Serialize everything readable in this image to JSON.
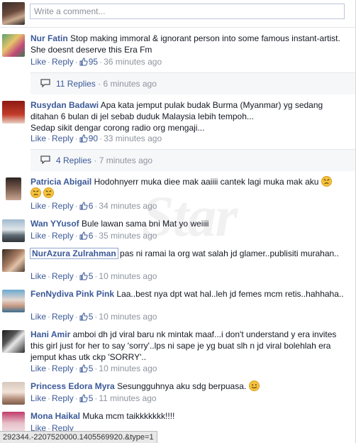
{
  "composer": {
    "placeholder": "Write a comment..."
  },
  "watermark": "Star",
  "action_labels": {
    "like": "Like",
    "reply": "Reply"
  },
  "comments": [
    {
      "author": "Nur Fatin",
      "text": "Stop making immoral & ignorant person into some famous instant-artist. She doesnt deserve this Era Fm",
      "likes": "95",
      "time": "36 minutes ago",
      "replies": {
        "count": "11 Replies",
        "time": "6 minutes ago"
      }
    },
    {
      "author": "Rusydan Badawi",
      "text": "Apa kata jemput pulak budak Burma (Myanmar) yg sedang ditahan 6 bulan di jel sebab duduk Malaysia lebih tempoh...",
      "text2": "Sedap sikit dengar corong radio org mengaji...",
      "likes": "90",
      "time": "33 minutes ago",
      "replies": {
        "count": "4 Replies",
        "time": "7 minutes ago"
      }
    },
    {
      "author": "Patricia Abigail",
      "text": "Hodohnyerr muka diee mak aaiiii cantek lagi muka mak aku",
      "likes": "6",
      "time": "34 minutes ago"
    },
    {
      "author": "Wan YYusof",
      "text": "Bule lawan sama bni Mat yo weiiii",
      "likes": "6",
      "time": "35 minutes ago"
    },
    {
      "author": "NurAzura Zulrahman",
      "text": "pas ni ramai la org wat salah jd glamer..publisiti murahan..",
      "likes": "5",
      "time": "10 minutes ago"
    },
    {
      "author": "FenNydiva Pink Pink",
      "text": "Laa..best nya dpt wat hal..leh jd femes mcm retis..hahhaha..",
      "likes": "5",
      "time": "10 minutes ago"
    },
    {
      "author": "Hani Amir",
      "text": "amboi dh jd viral baru nk mintak maaf...i don't understand y era invites this girl just for her to say 'sorry'..lps ni sape je yg buat slh n jd viral bolehlah era jemput khas utk ckp 'SORRY'..",
      "likes": "5",
      "time": "10 minutes ago"
    },
    {
      "author": "Princess Edora Myra",
      "text": "Sesungguhnya aku sdg berpuasa.",
      "likes": "5",
      "time": "11 minutes ago"
    },
    {
      "author": "Mona Haikal",
      "text": "Muka mcm taikkkkkkk!!!!"
    }
  ],
  "statusbar": "292344.-2207520000.1405569920.&type=1"
}
